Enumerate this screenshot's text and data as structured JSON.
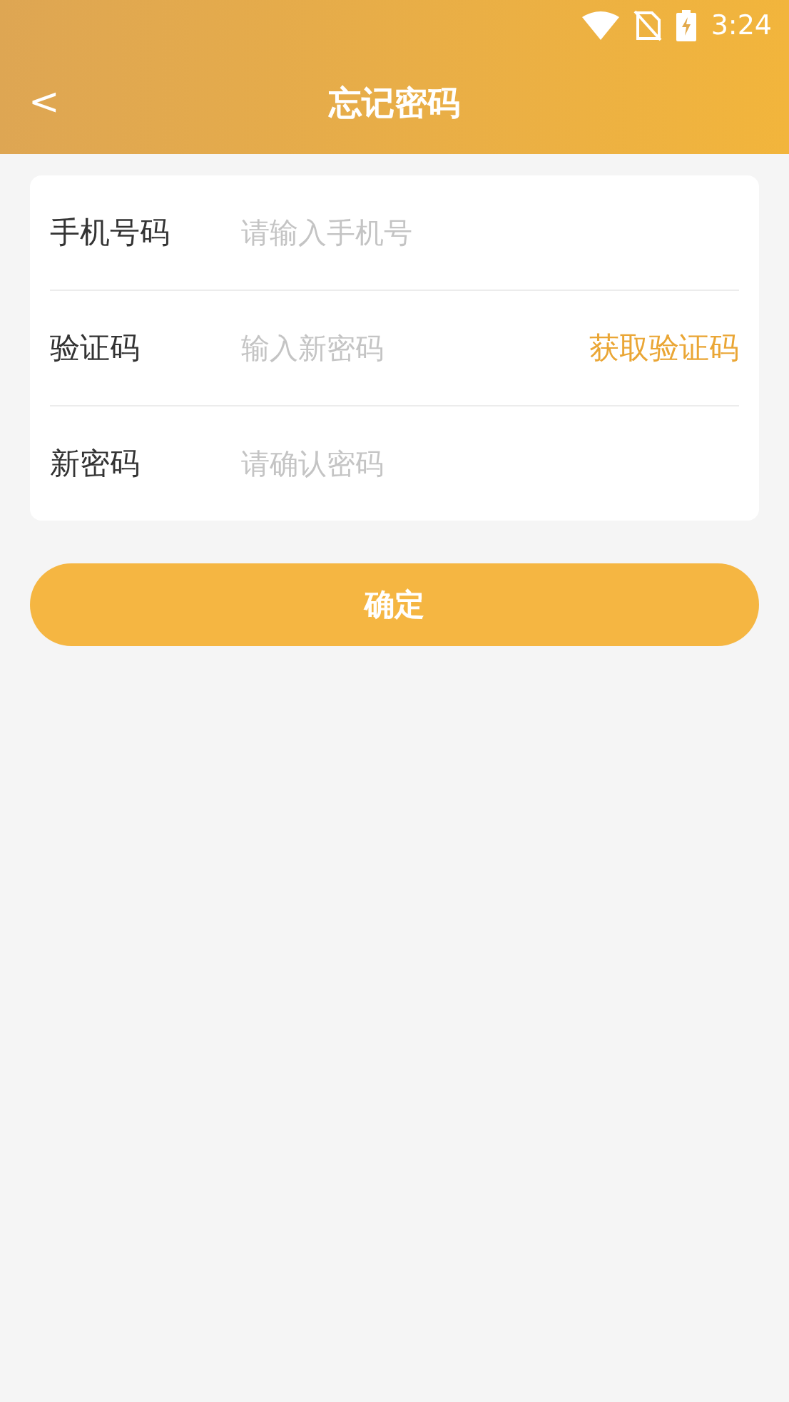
{
  "status_bar": {
    "time": "3:24"
  },
  "header": {
    "back": "<",
    "title": "忘记密码"
  },
  "form": {
    "rows": [
      {
        "kind": "input",
        "label": "手机号码",
        "placeholder": "请输入手机号"
      },
      {
        "kind": "code",
        "label": "验证码",
        "placeholder": "输入新密码",
        "action": "获取验证码"
      },
      {
        "kind": "input",
        "label": "新密码",
        "placeholder": "请确认密码"
      }
    ]
  },
  "submit": "确定"
}
